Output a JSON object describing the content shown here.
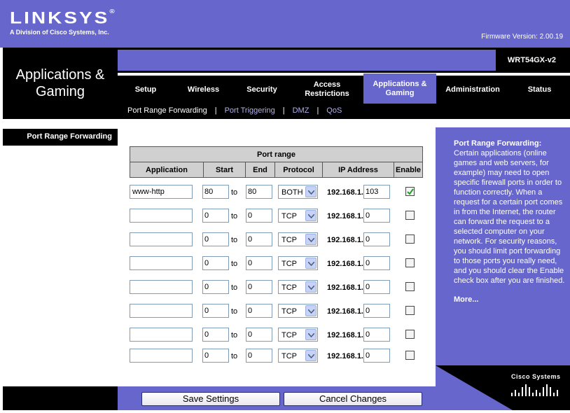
{
  "brand": {
    "logo": "LINKSYS",
    "logo_reg": "®",
    "subtitle": "A Division of Cisco Systems, Inc.",
    "firmware": "Firmware Version: 2.00.19"
  },
  "model": "WRT54GX-v2",
  "section_title": "Applications &\nGaming",
  "nav": {
    "tabs": [
      {
        "label": "Setup"
      },
      {
        "label": "Wireless"
      },
      {
        "label": "Security"
      },
      {
        "label": "Access\nRestrictions"
      },
      {
        "label": "Applications &\nGaming",
        "active": true
      },
      {
        "label": "Administration"
      },
      {
        "label": "Status"
      }
    ],
    "subtabs": [
      {
        "label": "Port Range Forwarding",
        "current": true
      },
      {
        "label": "Port Triggering"
      },
      {
        "label": "DMZ"
      },
      {
        "label": "QoS"
      }
    ],
    "separator": "|"
  },
  "left_panel": {
    "label": "Port Range Forwarding"
  },
  "table": {
    "group_header": "Port range",
    "headers": {
      "application": "Application",
      "start": "Start",
      "end": "End",
      "protocol": "Protocol",
      "ip": "IP Address",
      "enable": "Enable"
    },
    "to_label": "to",
    "ip_prefix": "192.168.1.",
    "rows": [
      {
        "app": "www-http",
        "start": "80",
        "end": "80",
        "protocol": "BOTH",
        "ip": "103",
        "enabled": true
      },
      {
        "app": "",
        "start": "0",
        "end": "0",
        "protocol": "TCP",
        "ip": "0",
        "enabled": false
      },
      {
        "app": "",
        "start": "0",
        "end": "0",
        "protocol": "TCP",
        "ip": "0",
        "enabled": false
      },
      {
        "app": "",
        "start": "0",
        "end": "0",
        "protocol": "TCP",
        "ip": "0",
        "enabled": false
      },
      {
        "app": "",
        "start": "0",
        "end": "0",
        "protocol": "TCP",
        "ip": "0",
        "enabled": false
      },
      {
        "app": "",
        "start": "0",
        "end": "0",
        "protocol": "TCP",
        "ip": "0",
        "enabled": false
      },
      {
        "app": "",
        "start": "0",
        "end": "0",
        "protocol": "TCP",
        "ip": "0",
        "enabled": false
      },
      {
        "app": "",
        "start": "0",
        "end": "0",
        "protocol": "TCP",
        "ip": "0",
        "enabled": false
      }
    ]
  },
  "help": {
    "title": "Port Range Forwarding:",
    "body": "Certain applications (online games and web servers, for example) may need to open specific firewall ports in order to function correctly. When a request for a certain port comes in from the Internet, the router can forward the request to a selected computer on your network. For security reasons, you should limit port forwarding to those ports you really need, and you should clear the Enable check box after you are finished.",
    "more": "More..."
  },
  "cisco": {
    "label": "Cisco Systems"
  },
  "buttons": {
    "save": "Save Settings",
    "cancel": "Cancel Changes"
  },
  "colors": {
    "brand_purple": "#6666cc",
    "header_black": "#000000",
    "table_header_gray": "#d0d0d0"
  },
  "icons": {
    "dropdown": "chevron-down-icon",
    "checkbox_checked": "check-icon",
    "cisco_logo": "cisco-bridge-icon"
  }
}
